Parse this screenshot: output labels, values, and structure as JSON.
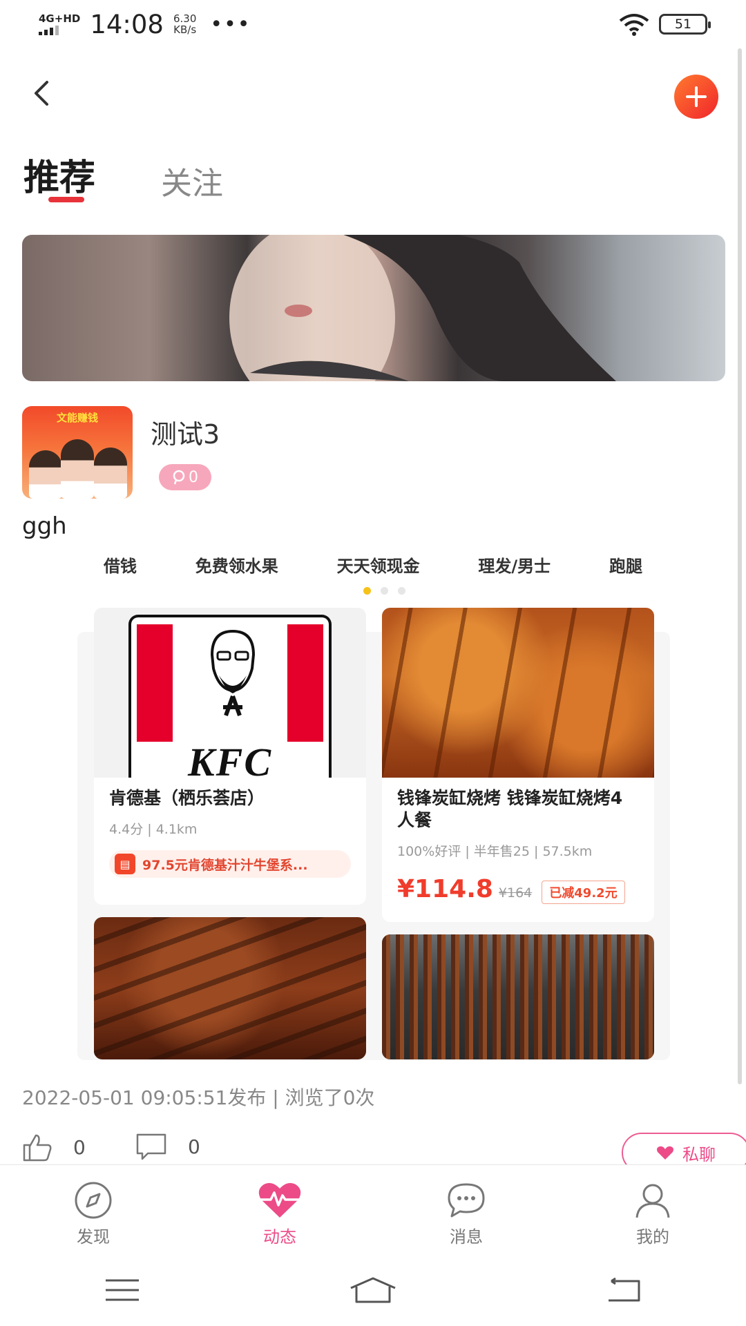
{
  "status_bar": {
    "network": "4G+HD",
    "time": "14:08",
    "speed_value": "6.30",
    "speed_unit": "KB/s",
    "more": "•••",
    "battery": "51"
  },
  "header": {
    "back_icon": "chevron-left-icon",
    "add_icon": "plus-icon",
    "add_color": "#f0252c"
  },
  "tabs": [
    {
      "label": "推荐",
      "active": true
    },
    {
      "label": "关注",
      "active": false
    }
  ],
  "post": {
    "author": "测试3",
    "avatar_caption": "文能赚钱",
    "comment_count": "0",
    "content": "ggh",
    "embedded": {
      "categories": [
        "借钱",
        "免费领水果",
        "天天领现金",
        "理发/男士",
        "跑腿"
      ],
      "page_dots": 3,
      "active_dot": 0,
      "cards": [
        {
          "title": "肯德基（栖乐荟店）",
          "sub": "4.4分 | 4.1km",
          "promo_icon": "ticket-icon",
          "promo": "97.5元肯德基汁汁牛堡系...",
          "logo_text": "KFC"
        },
        {
          "title": "钱锋炭缸烧烤 钱锋炭缸烧烤4人餐",
          "sub": "100%好评 | 半年售25 | 57.5km",
          "price": "¥114.8",
          "price_old": "¥164",
          "discount": "已减49.2元"
        }
      ]
    },
    "meta": "2022-05-01 09:05:51发布 | 浏览了0次",
    "like_count": "0",
    "comment_total": "0",
    "chat_label": "私聊"
  },
  "bottom_tabs": [
    {
      "label": "发现",
      "icon": "compass-icon",
      "active": false
    },
    {
      "label": "动态",
      "icon": "heartbeat-icon",
      "active": true
    },
    {
      "label": "消息",
      "icon": "chat-bubble-icon",
      "active": false
    },
    {
      "label": "我的",
      "icon": "user-icon",
      "active": false
    }
  ],
  "colors": {
    "accent_pink": "#ec4b88",
    "accent_red": "#e8333a",
    "price_red": "#f03c2c"
  }
}
